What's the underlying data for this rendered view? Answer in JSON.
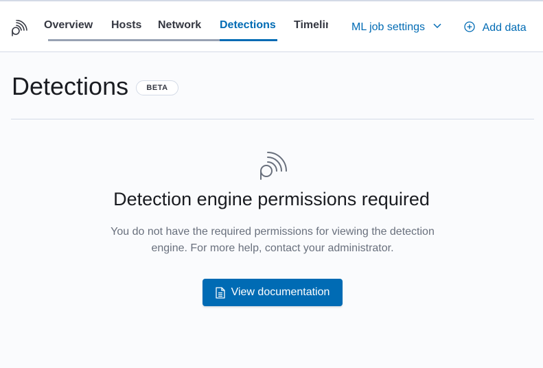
{
  "nav": {
    "tabs": [
      {
        "label": "Overview"
      },
      {
        "label": "Hosts"
      },
      {
        "label": "Network"
      },
      {
        "label": "Detections"
      },
      {
        "label": "Timelines"
      }
    ],
    "active_tab": "Detections",
    "ml_settings_label": "ML job settings",
    "add_data_label": "Add data"
  },
  "header": {
    "title": "Detections",
    "badge": "BETA"
  },
  "empty_state": {
    "title": "Detection engine permissions required",
    "body": "You do not have the required permissions for viewing the detection engine. For more help, contact your administrator.",
    "button_label": "View documentation"
  },
  "colors": {
    "accent": "#006bb4",
    "text": "#343741",
    "muted": "#69707d",
    "border": "#d3dae6",
    "background": "#fafbfd"
  },
  "icons": {
    "logo": "siem-app-icon",
    "ml_chevron": "chevron-down-icon",
    "add_data": "plus-circle-icon",
    "empty_state": "siem-app-icon",
    "doc_button": "document-icon"
  }
}
